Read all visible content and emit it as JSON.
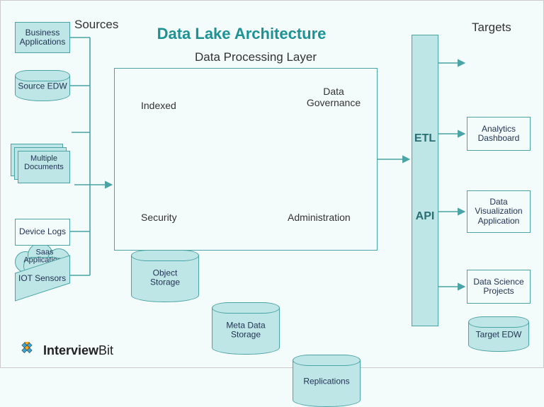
{
  "titles": {
    "main": "Data Lake Architecture",
    "sources": "Sources",
    "processing": "Data Processing Layer",
    "targets": "Targets",
    "indexed": "Indexed",
    "governance": "Data\nGovernance",
    "security": "Security",
    "administration": "Administration"
  },
  "sources": {
    "business_apps": "Business\nApplications",
    "source_edw": "Source EDW",
    "multi_docs": "Multiple\nDocuments",
    "saas": "Saas\nApplications",
    "device_logs": "Device Logs",
    "iot": "IOT Sensors"
  },
  "processing": {
    "object_storage": "Object\nStorage",
    "meta_storage": "Meta Data\nStorage",
    "replications": "Replications"
  },
  "etl_bar": {
    "etl": "ETL",
    "api": "API"
  },
  "targets": {
    "edw": "Target EDW",
    "analytics": "Analytics\nDashboard",
    "viz": "Data\nVisualization\nApplication",
    "datasci": "Data Science\nProjects"
  },
  "brand": {
    "part1": "Interview",
    "part2": "Bit"
  }
}
